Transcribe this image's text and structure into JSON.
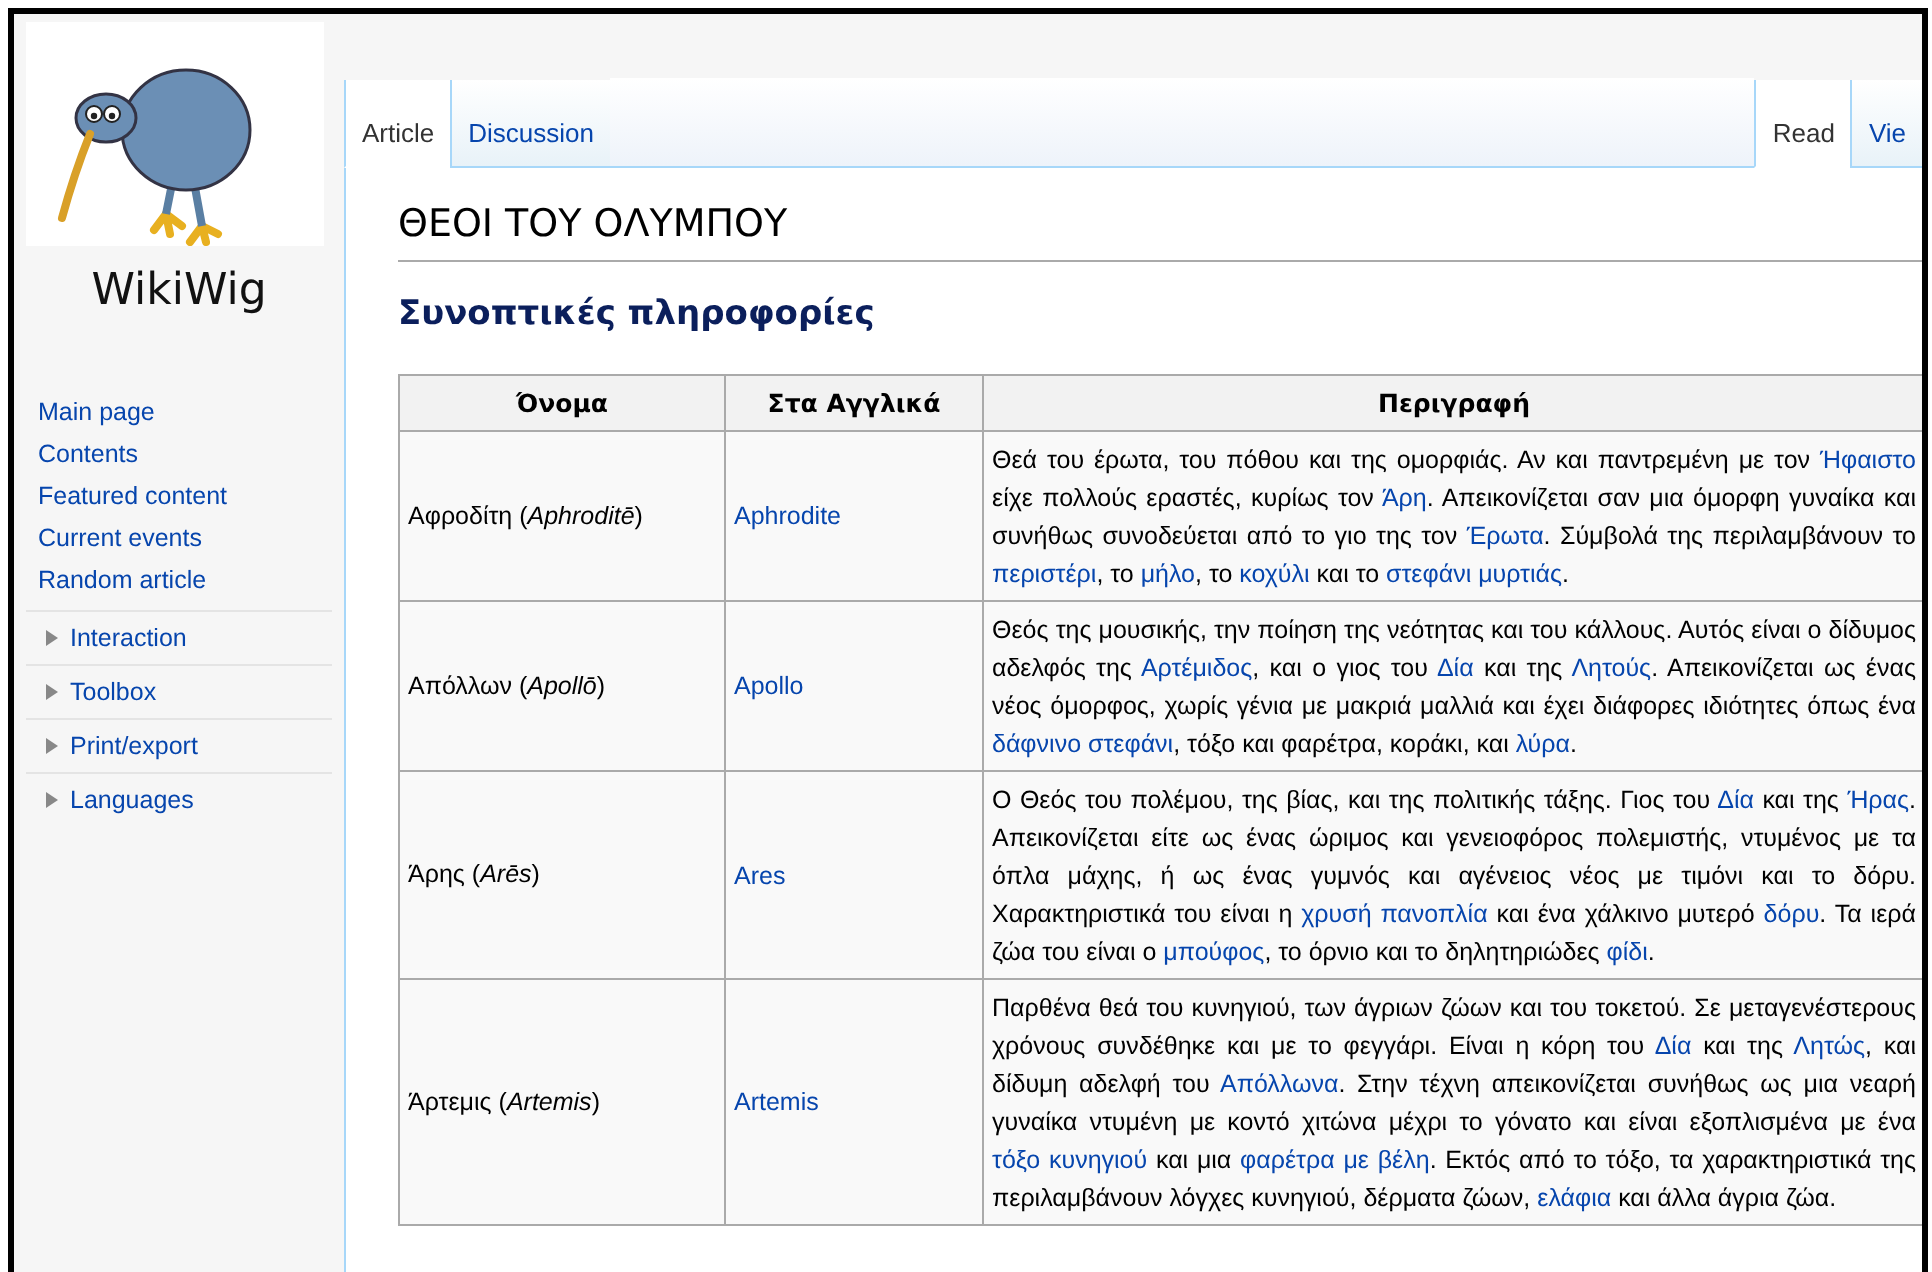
{
  "site": {
    "name": "WikiWig"
  },
  "sidebar": {
    "nav": [
      "Main page",
      "Contents",
      "Featured content",
      "Current events",
      "Random article"
    ],
    "portlets": [
      {
        "label": "Interaction",
        "expanded": false
      },
      {
        "label": "Toolbox",
        "expanded": false
      },
      {
        "label": "Print/export",
        "expanded": false
      },
      {
        "label": "Languages",
        "expanded": false
      }
    ]
  },
  "left_tabs": [
    {
      "label": "Article",
      "selected": true
    },
    {
      "label": "Discussion",
      "selected": false
    }
  ],
  "right_tabs": [
    {
      "label": "Read",
      "selected": true
    },
    {
      "label": "Vie",
      "selected": false
    }
  ],
  "article": {
    "title": "ΘΕΟΙ ΤΟΥ ΟΛΥΜΠΟΥ",
    "section": "Συνοπτικές πληροφορίες",
    "table": {
      "columns": [
        "Όνομα",
        "Στα Αγγλικά",
        "Περιγραφή"
      ],
      "rows": [
        {
          "name": "Αφροδίτη (*Aphroditē*)",
          "english": "Aphrodite",
          "description": [
            {
              "kind": "text",
              "text": "Θεά του έρωτα, του πόθου και της ομορφιάς. Αν και παντρεμένη με τον "
            },
            {
              "kind": "link",
              "text": "Ήφαιστο"
            },
            {
              "kind": "text",
              "text": " είχε πολλούς εραστές, κυρίως τον "
            },
            {
              "kind": "link",
              "text": "Άρη"
            },
            {
              "kind": "text",
              "text": ". Απεικονίζεται σαν μια όμορφη γυναίκα και συνήθως συνοδεύεται από το γιο της τον "
            },
            {
              "kind": "link",
              "text": "Έρωτα"
            },
            {
              "kind": "text",
              "text": ". Σύμβολά της περιλαμβάνουν το "
            },
            {
              "kind": "link",
              "text": "περιστέρι"
            },
            {
              "kind": "text",
              "text": ", το "
            },
            {
              "kind": "link",
              "text": "μήλο"
            },
            {
              "kind": "text",
              "text": ", το "
            },
            {
              "kind": "link",
              "text": "κοχύλι"
            },
            {
              "kind": "text",
              "text": " και το "
            },
            {
              "kind": "link",
              "text": "στεφάνι μυρτιάς"
            },
            {
              "kind": "text",
              "text": "."
            }
          ]
        },
        {
          "name": "Απόλλων (*Apollō*)",
          "english": "Apollo",
          "description": [
            {
              "kind": "text",
              "text": "Θεός της μουσικής, την ποίηση της νεότητας και του κάλλους. Αυτός είναι ο δίδυμος αδελφός της "
            },
            {
              "kind": "link",
              "text": "Αρτέμιδος"
            },
            {
              "kind": "text",
              "text": ", και ο γιος του "
            },
            {
              "kind": "link",
              "text": "Δία"
            },
            {
              "kind": "text",
              "text": " και της "
            },
            {
              "kind": "link",
              "text": "Λητούς"
            },
            {
              "kind": "text",
              "text": ". Απεικονίζεται ως ένας νέος όμορφος, χωρίς γένια με μακριά μαλλιά και έχει διάφορες ιδιότητες όπως ένα "
            },
            {
              "kind": "link",
              "text": "δάφνινο στεφάνι"
            },
            {
              "kind": "text",
              "text": ", τόξο και φαρέτρα, κοράκι, και "
            },
            {
              "kind": "link",
              "text": "λύρα"
            },
            {
              "kind": "text",
              "text": "."
            }
          ]
        },
        {
          "name": "Άρης (*Arēs*)",
          "english": "Ares",
          "description": [
            {
              "kind": "text",
              "text": "Ο Θεός του πολέμου, της βίας, και της πολιτικής τάξης. Γιος του "
            },
            {
              "kind": "link",
              "text": "Δία"
            },
            {
              "kind": "text",
              "text": " και της "
            },
            {
              "kind": "link",
              "text": "Ήρας"
            },
            {
              "kind": "text",
              "text": ". Απεικονίζεται είτε ως ένας ώριμος και γενειοφόρος πολεμιστής, ντυμένος με τα όπλα μάχης, ή ως ένας γυμνός και αγένειος νέος με τιμόνι και το δόρυ. Χαρακτηριστικά του είναι η "
            },
            {
              "kind": "link",
              "text": "χρυσή πανοπλία"
            },
            {
              "kind": "text",
              "text": " και ένα χάλκινο μυτερό "
            },
            {
              "kind": "link",
              "text": "δόρυ"
            },
            {
              "kind": "text",
              "text": ". Τα ιερά ζώα του είναι ο "
            },
            {
              "kind": "link",
              "text": "μπούφος"
            },
            {
              "kind": "text",
              "text": ", το όρνιο και το δηλητηριώδες "
            },
            {
              "kind": "link",
              "text": "φίδι"
            },
            {
              "kind": "text",
              "text": "."
            }
          ]
        },
        {
          "name": "Άρτεμις (*Artemis*)",
          "english": "Artemis",
          "description": [
            {
              "kind": "text",
              "text": "Παρθένα θεά του κυνηγιού, των άγριων ζώων και του τοκετού. Σε μεταγενέστερους χρόνους συνδέθηκε και με το φεγγάρι. Είναι η κόρη του "
            },
            {
              "kind": "link",
              "text": "Δία"
            },
            {
              "kind": "text",
              "text": " και της "
            },
            {
              "kind": "link",
              "text": "Λητώς"
            },
            {
              "kind": "text",
              "text": ", και δίδυμη αδελφή του "
            },
            {
              "kind": "link",
              "text": "Απόλλωνα"
            },
            {
              "kind": "text",
              "text": ". Στην τέχνη απεικονίζεται συνήθως ως μια νεαρή γυναίκα ντυμένη με κοντό χιτώνα μέχρι το γόνατο και είναι εξοπλισμένα με ένα "
            },
            {
              "kind": "link",
              "text": "τόξο κυνηγιού"
            },
            {
              "kind": "text",
              "text": " και μια "
            },
            {
              "kind": "link",
              "text": "φαρέτρα με βέλη"
            },
            {
              "kind": "text",
              "text": ". Εκτός από το τόξο, τα χαρακτηριστικά της περιλαμβάνουν λόγχες κυνηγιού, δέρματα ζώων, "
            },
            {
              "kind": "link",
              "text": "ελάφια"
            },
            {
              "kind": "text",
              "text": " και άλλα άγρια ζώα."
            }
          ]
        }
      ]
    }
  }
}
